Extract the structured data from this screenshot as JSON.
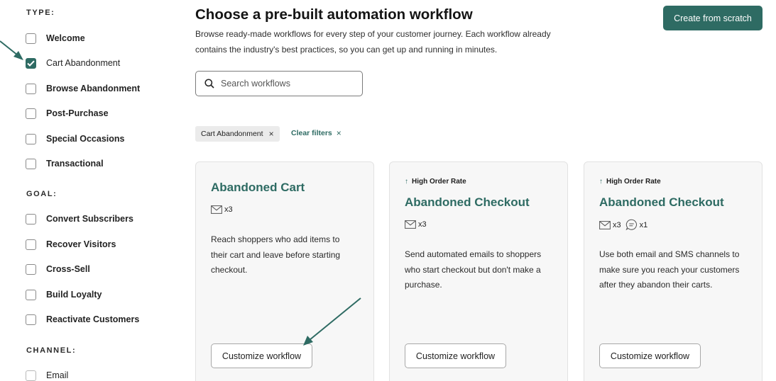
{
  "sidebar": {
    "type_heading": "TYPE:",
    "type_items": [
      {
        "label": "Welcome",
        "checked": false
      },
      {
        "label": "Cart Abandonment",
        "checked": true
      },
      {
        "label": "Browse Abandonment",
        "checked": false
      },
      {
        "label": "Post-Purchase",
        "checked": false
      },
      {
        "label": "Special Occasions",
        "checked": false
      },
      {
        "label": "Transactional",
        "checked": false
      }
    ],
    "goal_heading": "GOAL:",
    "goal_items": [
      {
        "label": "Convert Subscribers",
        "checked": false
      },
      {
        "label": "Recover Visitors",
        "checked": false
      },
      {
        "label": "Cross-Sell",
        "checked": false
      },
      {
        "label": "Build Loyalty",
        "checked": false
      },
      {
        "label": "Reactivate Customers",
        "checked": false
      }
    ],
    "channel_heading": "CHANNEL:",
    "channel_items": [
      {
        "label": "Email",
        "checked": false
      }
    ]
  },
  "header": {
    "title": "Choose a pre-built automation workflow",
    "description": "Browse ready-made workflows for every step of your customer journey. Each workflow already contains the industry's best practices, so you can get up and running in minutes.",
    "create_button": "Create from scratch"
  },
  "search": {
    "placeholder": "Search workflows",
    "icon": "search-icon"
  },
  "filters": {
    "active_chip": "Cart Abandonment",
    "chip_remove": "×",
    "clear_label": "Clear filters",
    "clear_icon": "×"
  },
  "cards": [
    {
      "badge": "",
      "title": "Abandoned Cart",
      "email_count": "x3",
      "sms_count": "",
      "description": "Reach shoppers who add items to their cart and leave before starting checkout.",
      "button": "Customize workflow"
    },
    {
      "badge_arrow": "↑",
      "badge": "High Order Rate",
      "title": "Abandoned Checkout",
      "email_count": "x3",
      "sms_count": "",
      "description": "Send automated emails to shoppers who start checkout but don't make a purchase.",
      "button": "Customize workflow"
    },
    {
      "badge_arrow": "↑",
      "badge": "High Order Rate",
      "title": "Abandoned Checkout",
      "email_count": "x3",
      "sms_count": "x1",
      "description": "Use both email and SMS channels to make sure you reach your customers after they abandon their carts.",
      "button": "Customize workflow"
    }
  ],
  "colors": {
    "accent": "#2e6b63",
    "card_bg": "#f7f7f7",
    "chip_bg": "#ebebeb"
  }
}
